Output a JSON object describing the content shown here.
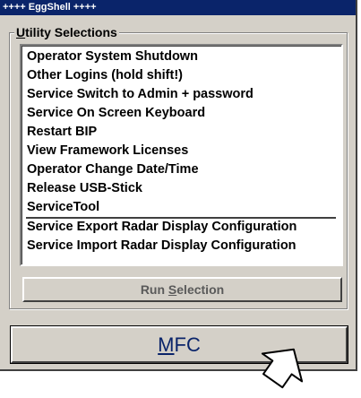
{
  "window": {
    "title": "++++ EggShell ++++"
  },
  "group": {
    "legend_prefix": "U",
    "legend_rest": "tility Selections"
  },
  "list": {
    "items": [
      "Operator System Shutdown",
      "Other Logins (hold shift!)",
      "Service Switch to Admin + password",
      "Service On Screen Keyboard",
      "Restart BIP",
      "View Framework Licenses",
      "Operator Change Date/Time",
      "Release USB-Stick",
      "ServiceTool",
      "Service Export Radar Display Configuration",
      "Service Import Radar Display Configuration"
    ]
  },
  "buttons": {
    "run_prefix": "Run ",
    "run_underlined": "S",
    "run_rest": "election",
    "mfc_underlined": "M",
    "mfc_rest": "FC"
  },
  "icons": {
    "pointer": "hand-pointer-cursor-icon"
  },
  "colors": {
    "titlebar": "#0a246a",
    "window_face": "#d4d0c8",
    "mfc_text": "#0a246a"
  }
}
